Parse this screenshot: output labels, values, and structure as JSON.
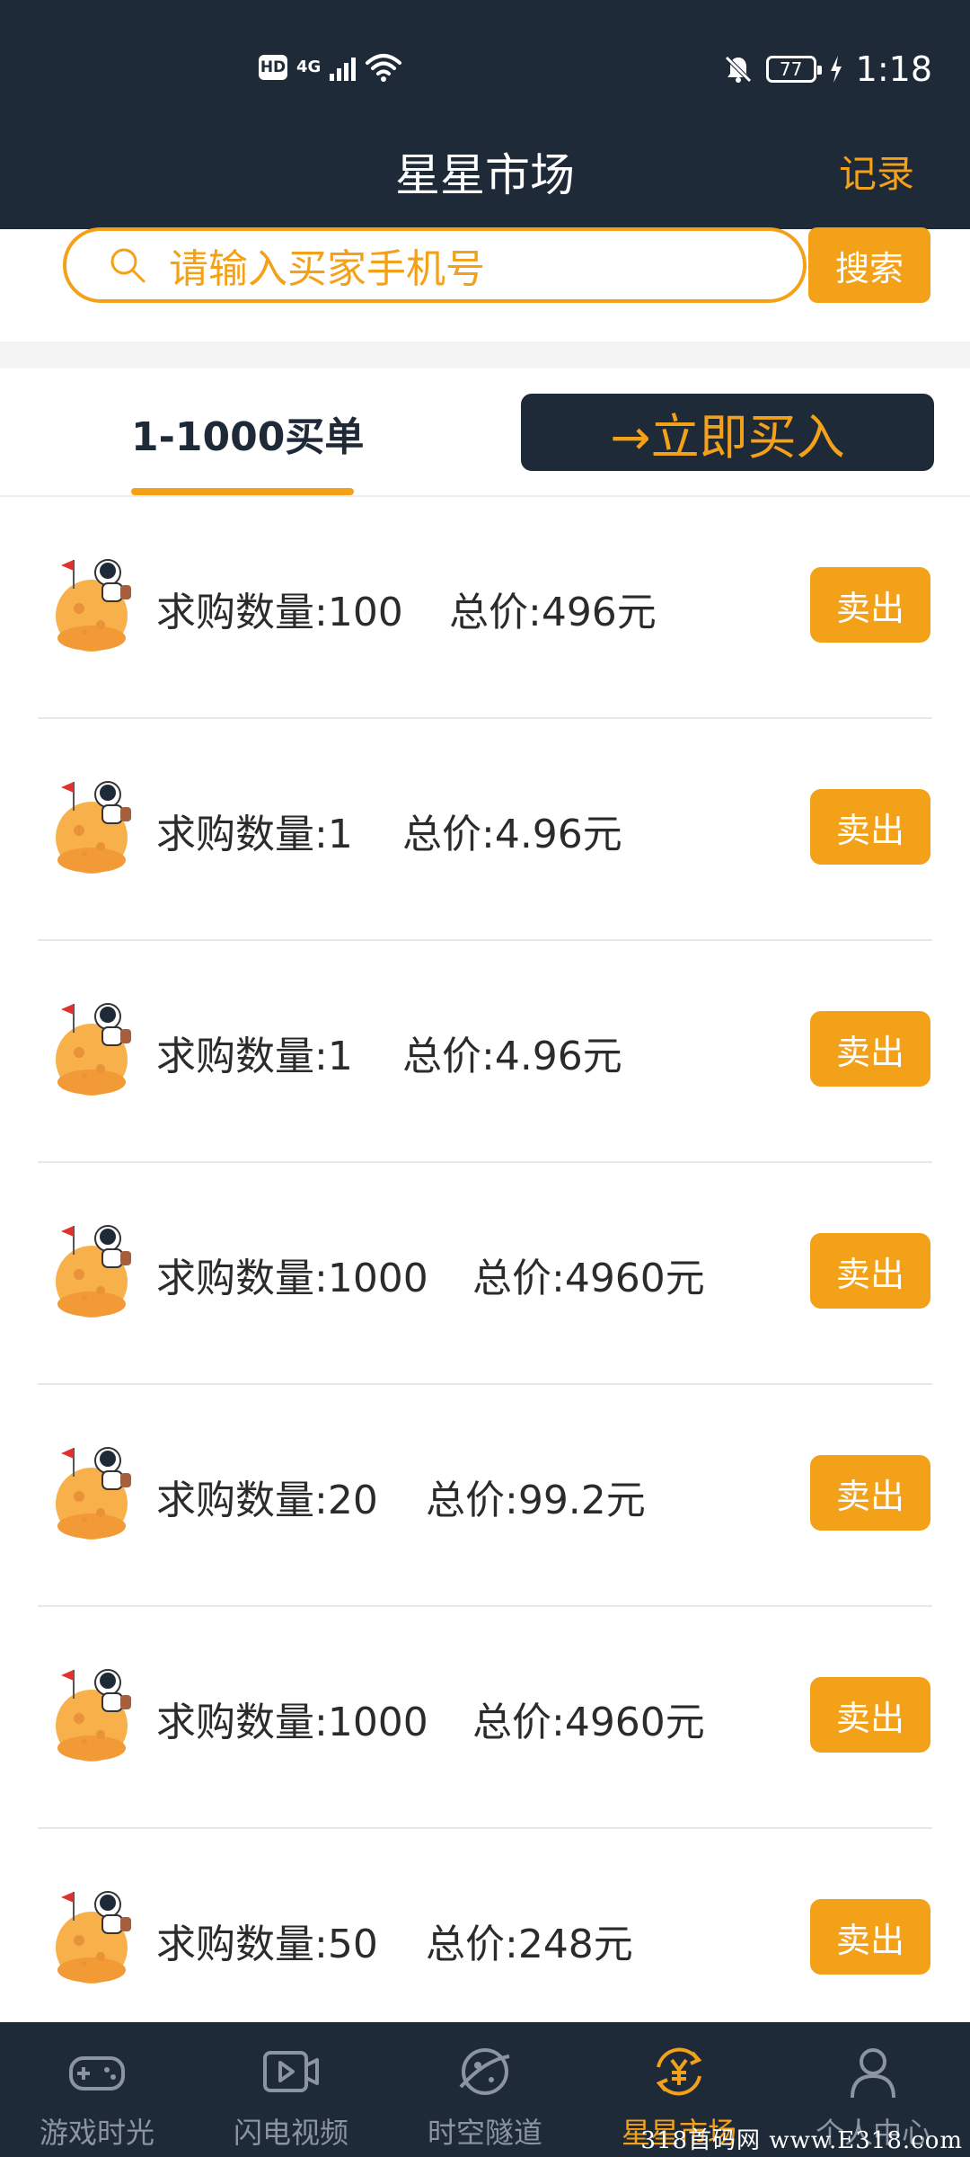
{
  "status_bar": {
    "hd": "HD",
    "network": "4G",
    "battery": "77",
    "time": "1:18"
  },
  "header": {
    "title": "星星市场",
    "records_label": "记录"
  },
  "search": {
    "placeholder": "请输入买家手机号",
    "button_label": "搜索"
  },
  "tabs": {
    "active_label": "1-1000买单",
    "buy_button_label": "→立即买入"
  },
  "orders": [
    {
      "qty": "求购数量:100",
      "price": "总价:496元",
      "action": "卖出"
    },
    {
      "qty": "求购数量:1",
      "price": "总价:4.96元",
      "action": "卖出"
    },
    {
      "qty": "求购数量:1",
      "price": "总价:4.96元",
      "action": "卖出"
    },
    {
      "qty": "求购数量:1000",
      "price": "总价:4960元",
      "action": "卖出"
    },
    {
      "qty": "求购数量:20",
      "price": "总价:99.2元",
      "action": "卖出"
    },
    {
      "qty": "求购数量:1000",
      "price": "总价:4960元",
      "action": "卖出"
    },
    {
      "qty": "求购数量:50",
      "price": "总价:248元",
      "action": "卖出"
    }
  ],
  "bottom_nav": [
    {
      "label": "游戏时光",
      "icon": "gamepad-icon"
    },
    {
      "label": "闪电视频",
      "icon": "video-icon"
    },
    {
      "label": "时空隧道",
      "icon": "planet-icon"
    },
    {
      "label": "星星市场",
      "icon": "yuan-exchange-icon",
      "active": true
    },
    {
      "label": "个人中心",
      "icon": "person-icon"
    }
  ],
  "watermark": "318首码网 www.E318.com",
  "colors": {
    "accent": "#f4a11a",
    "header_bg": "#1f2a38",
    "nav_inactive": "#8a94a3"
  }
}
